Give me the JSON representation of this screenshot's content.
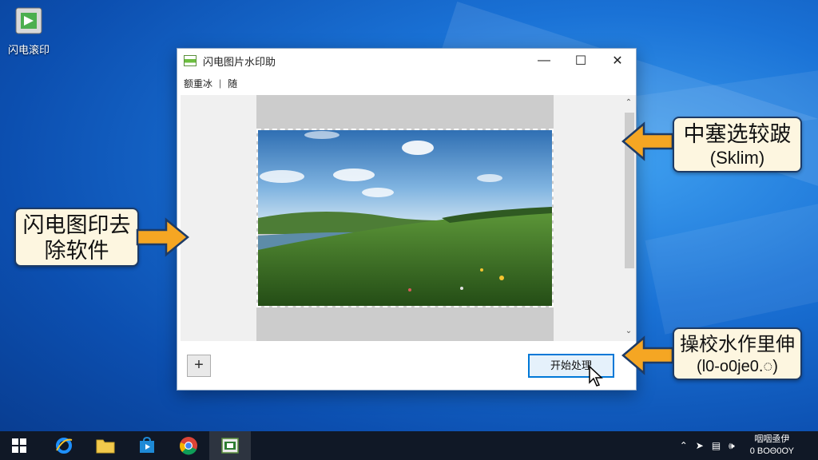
{
  "desktop": {
    "icon_label": "闪电滚印"
  },
  "window": {
    "title": "闪电图片水印助",
    "controls": {
      "minimize": "—",
      "maximize": "☐",
      "close": "✕"
    },
    "menu": {
      "item1": "额重冰",
      "separator": "|",
      "item2": "随"
    },
    "add_button": "+",
    "start_button": "开始处理"
  },
  "callouts": {
    "left_line1": "闪电图印去",
    "left_line2": "除软件",
    "top_right_line1": "中塞选较跛",
    "top_right_line2": "(Sklim)",
    "bottom_right_line1": "操校水作里伸",
    "bottom_right_line2": "(l0-o0je0.◌)"
  },
  "taskbar": {
    "tray_icons": [
      "chevron-up-icon",
      "network-icon",
      "keyboard-icon",
      "volume-icon"
    ],
    "clock_line1": "咽咽亟伊",
    "clock_line2": "0 ΒΟΘ0ΟΥ"
  },
  "colors": {
    "callout_border": "#1d3b66",
    "callout_bg": "#fdf6e0",
    "arrow": "#f5a623",
    "accent": "#0078d7"
  }
}
